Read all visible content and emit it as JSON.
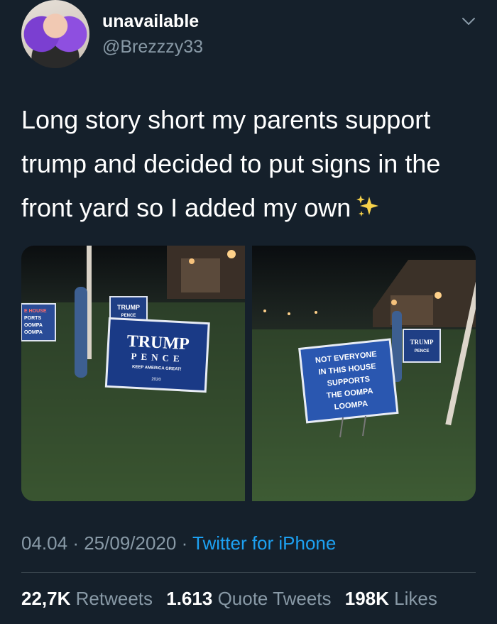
{
  "user": {
    "display_name": "unavailable",
    "handle": "@Brezzzy33"
  },
  "tweet": {
    "text": "Long story short my parents support trump and decided to put signs in the front yard so I added my own",
    "emoji": "sparkles"
  },
  "photos": {
    "left": {
      "sign_main": [
        "TRUMP",
        "PENCE",
        "KEEP AMERICA GREAT!",
        "2020"
      ],
      "sign_back": [
        "TRUMP",
        "PENCE"
      ],
      "sign_edge": [
        "E HOUSE",
        "PORTS",
        "OOMPA",
        "OOMPA"
      ]
    },
    "right": {
      "sign_main": [
        "NOT EVERYONE",
        "IN THIS HOUSE",
        "SUPPORTS",
        "THE OOMPA",
        "LOOMPA"
      ],
      "sign_back": [
        "TRUMP",
        "PENCE"
      ]
    }
  },
  "meta": {
    "time": "04.04",
    "separator": "·",
    "date": "25/09/2020",
    "source": "Twitter for iPhone"
  },
  "stats": {
    "retweets_count": "22,7K",
    "retweets_label": "Retweets",
    "quotes_count": "1.613",
    "quotes_label": "Quote Tweets",
    "likes_count": "198K",
    "likes_label": "Likes"
  },
  "colors": {
    "background": "#15202b",
    "text": "#ffffff",
    "secondary": "#8899a6",
    "link": "#1da1f2",
    "divider": "#38444d"
  }
}
